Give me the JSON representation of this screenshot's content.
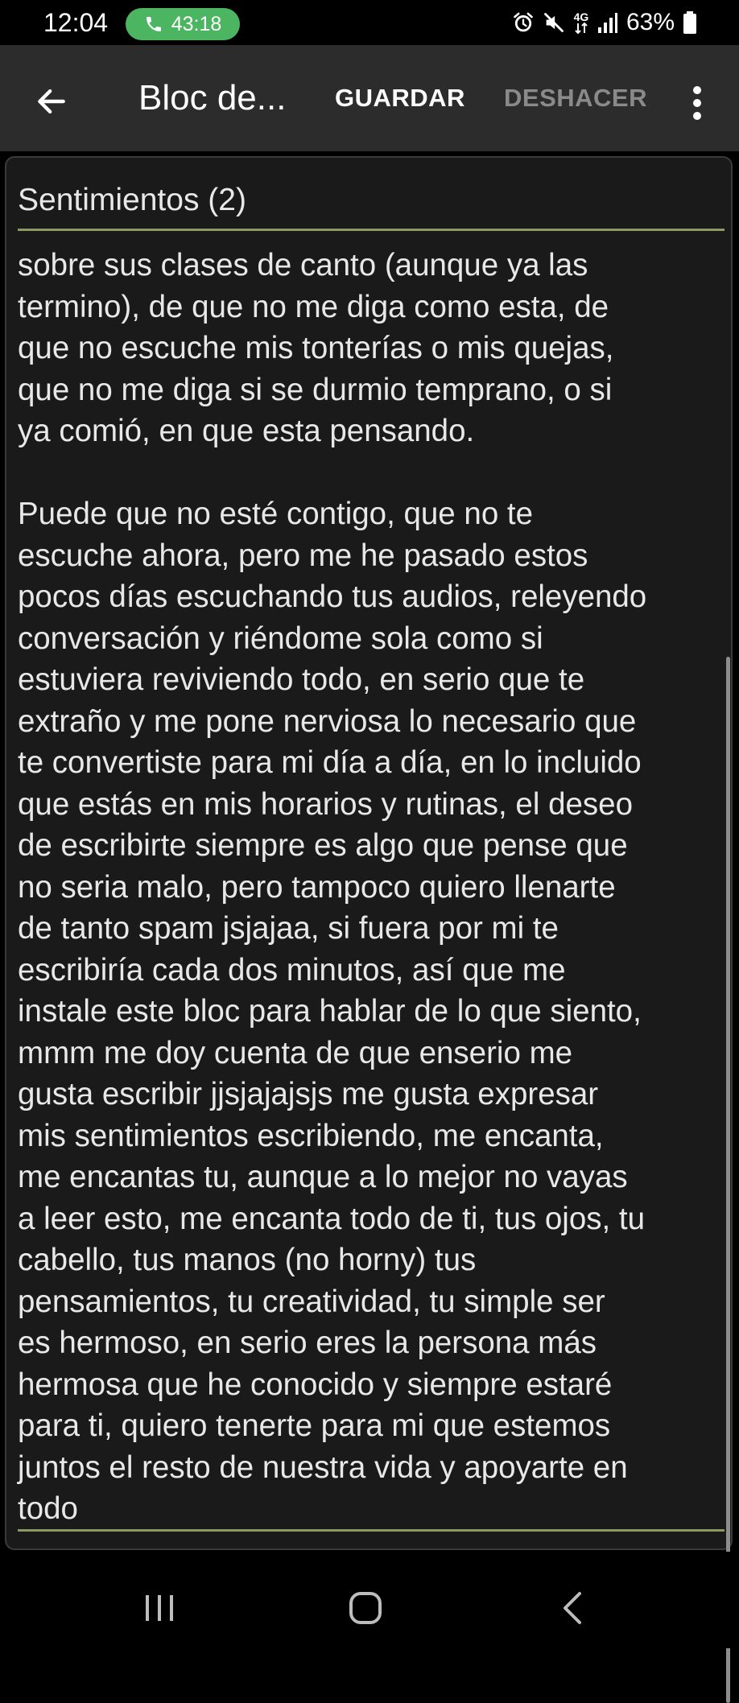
{
  "status_bar": {
    "time": "12:04",
    "call_timer": "43:18",
    "network": "4G",
    "battery": "63%",
    "icons": [
      "alarm-icon",
      "mute-icon",
      "4g-icon",
      "signal-icon",
      "battery-icon"
    ]
  },
  "app_bar": {
    "title": "Bloc de...",
    "save_label": "GUARDAR",
    "undo_label": "DESHACER"
  },
  "note": {
    "title": "Sentimientos (2)",
    "body": "sobre sus clases de canto (aunque ya las\ntermino), de que no me diga como esta, de\nque no escuche mis tonterías o mis quejas,\nque no me diga si se durmio temprano, o si\nya comió, en que esta pensando.\n\nPuede que no esté contigo, que no te\nescuche ahora, pero me he pasado estos\npocos días escuchando tus audios, releyendo\nconversación y riéndome sola como si\nestuviera reviviendo todo, en serio que te\nextraño y me pone nerviosa lo necesario que\nte convertiste para mi día a día, en lo incluido\nque estás en mis horarios y rutinas, el deseo\nde escribirte siempre es algo que pense que\nno seria malo, pero tampoco quiero llenarte\nde tanto spam jsjajaa, si fuera por mi te\nescribiría cada dos minutos, así que me\ninstale este bloc para hablar de lo que siento,\nmmm me doy cuenta de que enserio me\ngusta escribir jjsjajajsjs me gusta expresar\nmis sentimientos escribiendo, me encanta,\nme encantas tu, aunque a lo mejor no vayas\na leer esto, me encanta todo de ti, tus ojos, tu\ncabello, tus manos (no horny) tus\npensamientos, tu creatividad, tu simple ser\nes hermoso, en serio eres la persona más\nhermosa que he conocido y siempre estaré\npara ti, quiero tenerte para mi que estemos\njuntos el resto de nuestra vida y apoyarte en\ntodo"
  },
  "colors": {
    "app_bar_bg": "#2c2c2c",
    "note_bg": "#1a1a1a",
    "accent_rule": "#8a9a62",
    "call_pill": "#4cb561",
    "disabled_text": "#8a8a8a"
  },
  "nav_bar": {
    "icons": [
      "recent-apps-icon",
      "home-icon",
      "back-nav-icon"
    ]
  }
}
